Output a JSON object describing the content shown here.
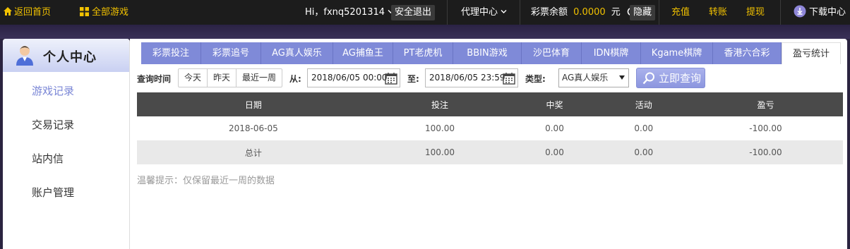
{
  "topbar": {
    "home_label": "返回首页",
    "all_games_label": "全部游戏",
    "greeting": "Hi，fxnq5201314",
    "logout_label": "安全退出",
    "agent_label": "代理中心",
    "balance_label": "彩票余额",
    "balance_value": "0.0000",
    "balance_unit": "元",
    "hide_label": "隐藏",
    "recharge_label": "充值",
    "transfer_label": "转账",
    "withdraw_label": "提现",
    "download_label": "下载中心"
  },
  "sidebar": {
    "title": "个人中心",
    "items": [
      {
        "label": "游戏记录",
        "active": true
      },
      {
        "label": "交易记录",
        "active": false
      },
      {
        "label": "站内信",
        "active": false
      },
      {
        "label": "账户管理",
        "active": false
      }
    ]
  },
  "tabs": [
    "彩票投注",
    "彩票追号",
    "AG真人娱乐",
    "AG捕鱼王",
    "PT老虎机",
    "BBIN游戏",
    "沙巴体育",
    "IDN棋牌",
    "Kgame棋牌",
    "香港六合彩",
    "盈亏统计"
  ],
  "active_tab": "盈亏统计",
  "query": {
    "time_label": "查询时间",
    "range_options": [
      "今天",
      "昨天",
      "最近一周"
    ],
    "from_label": "从:",
    "from_value": "2018/06/05 00:00",
    "to_label": "至:",
    "to_value": "2018/06/05 23:59",
    "type_label": "类型:",
    "type_value": "AG真人娱乐",
    "search_label": "立即查询"
  },
  "table": {
    "headers": [
      "日期",
      "投注",
      "中奖",
      "活动",
      "盈亏"
    ],
    "rows": [
      [
        "2018-06-05",
        "100.00",
        "0.00",
        "0.00",
        "-100.00"
      ],
      [
        "总计",
        "100.00",
        "0.00",
        "0.00",
        "-100.00"
      ]
    ]
  },
  "tip": "温馨提示：仅保留最近一周的数据",
  "colors": {
    "accent_gold": "#f2c200",
    "tab_purple": "#7f8ad8",
    "header_dark": "#4a4a4a"
  }
}
